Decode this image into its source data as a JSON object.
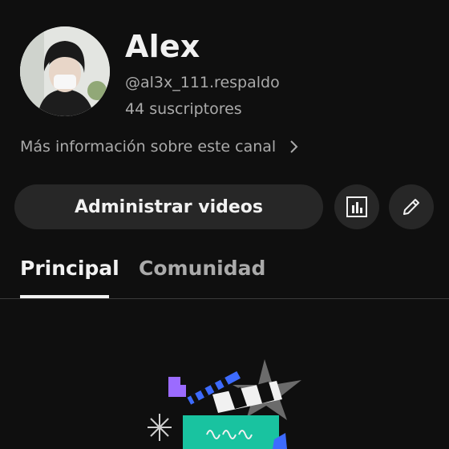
{
  "channel": {
    "name": "Alex",
    "handle": "@al3x_111.respaldo",
    "subscribers": "44 suscriptores",
    "more_info": "Más información sobre este canal"
  },
  "actions": {
    "manage_videos": "Administrar videos",
    "stats_icon": "bar-chart-icon",
    "edit_icon": "pencil-icon"
  },
  "tabs": [
    {
      "label": "Principal",
      "active": true
    },
    {
      "label": "Comunidad",
      "active": false
    }
  ],
  "colors": {
    "background": "#0f0f0f",
    "button_bg": "#272727",
    "text_primary": "#f1f1f1",
    "text_secondary": "#aaaaaa"
  }
}
